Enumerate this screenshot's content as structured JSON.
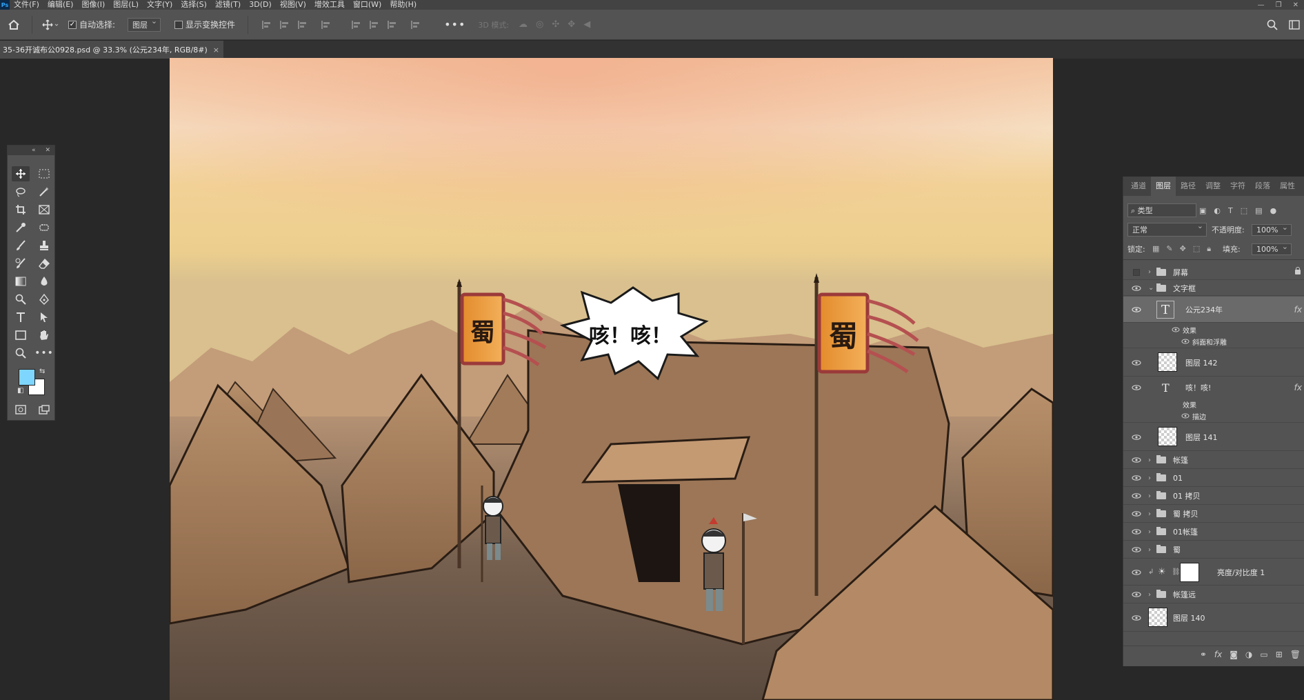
{
  "menubar": {
    "logo": "Ps",
    "items": [
      "文件(F)",
      "编辑(E)",
      "图像(I)",
      "图层(L)",
      "文字(Y)",
      "选择(S)",
      "滤镜(T)",
      "3D(D)",
      "视图(V)",
      "增效工具",
      "窗口(W)",
      "帮助(H)"
    ],
    "window_buttons": [
      "—",
      "❐",
      "✕"
    ]
  },
  "options": {
    "auto_select_label": "自动选择:",
    "auto_select_value": "图层",
    "show_transform_label": "显示变换控件",
    "mode_3d_label": "3D 模式:"
  },
  "document": {
    "tab_title": "35-36开诚布公0928.psd @ 33.3% (公元234年, RGB/8#)",
    "close": "×"
  },
  "canvas": {
    "banner_left": "蜀",
    "banner_right": "蜀",
    "speech_text": "咳！咳！"
  },
  "tools": {
    "fg_color": "#7ed6ff",
    "bg_color": "#ffffff"
  },
  "layers_panel": {
    "tabs": [
      "通道",
      "图层",
      "路径",
      "调整",
      "字符",
      "段落",
      "属性"
    ],
    "active_tab": "图层",
    "filter_label": "类型",
    "blend_mode": "正常",
    "opacity_label": "不透明度:",
    "opacity_value": "100%",
    "lock_label": "锁定:",
    "fill_label": "填充:",
    "fill_value": "100%",
    "layers": [
      {
        "name": "屏幕",
        "kind": "group",
        "visible": false,
        "locked": true
      },
      {
        "name": "文字框",
        "kind": "group",
        "visible": true,
        "expanded": true
      },
      {
        "name": "公元234年",
        "kind": "text",
        "visible": true,
        "selected": true,
        "fx": "fx"
      },
      {
        "name": "效果",
        "kind": "effect-header"
      },
      {
        "name": "斜面和浮雕",
        "kind": "effect"
      },
      {
        "name": "图层 142",
        "kind": "pixel",
        "visible": true
      },
      {
        "name": "咳！咳!",
        "kind": "text",
        "visible": true,
        "fx": "fx"
      },
      {
        "name": "效果",
        "kind": "effect-header"
      },
      {
        "name": "描边",
        "kind": "effect"
      },
      {
        "name": "图层 141",
        "kind": "pixel",
        "visible": true
      },
      {
        "name": "帐篷",
        "kind": "group",
        "visible": true
      },
      {
        "name": "01",
        "kind": "group",
        "visible": true
      },
      {
        "name": "01 拷贝",
        "kind": "group",
        "visible": true
      },
      {
        "name": "蜀 拷贝",
        "kind": "group",
        "visible": true
      },
      {
        "name": "01帐篷",
        "kind": "group",
        "visible": true
      },
      {
        "name": "蜀",
        "kind": "group",
        "visible": true
      },
      {
        "name": "亮度/对比度 1",
        "kind": "adjustment",
        "visible": true
      },
      {
        "name": "帐篷远",
        "kind": "group",
        "visible": true
      },
      {
        "name": "图层 140",
        "kind": "pixel",
        "visible": true
      }
    ]
  }
}
